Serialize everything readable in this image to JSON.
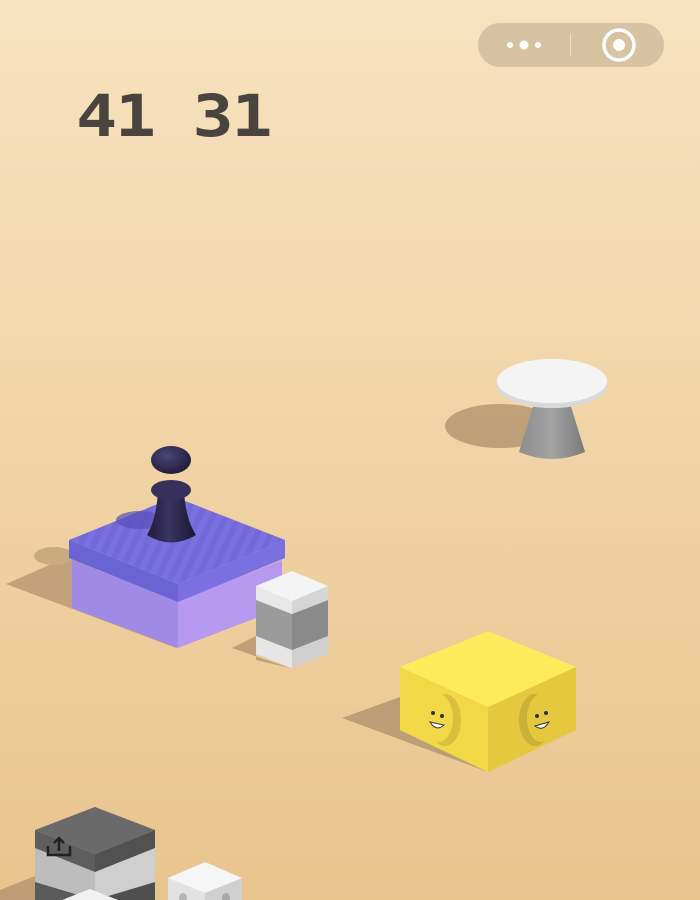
{
  "colors": {
    "background_top": "#f7e3bf",
    "background_bottom": "#e9c48d",
    "shadow": "#b89a73",
    "score_text": "#4a4440",
    "capsule": "#c8b79f",
    "purple_top": "#7a70e0",
    "purple_front": "#9f8be6",
    "purple_side": "#b79af0",
    "purple_rim": "#6b63d4",
    "player": "#2c2747",
    "yellow_top": "#fdeb5c",
    "yellow_left": "#f2d846",
    "yellow_right": "#e5c83e",
    "white_top": "#f4f4f4",
    "gray_band": "#9b9b9b",
    "dark_gray_top": "#6a6a6a"
  },
  "hud": {
    "score": "41 31",
    "more_icon": "more-dots-icon",
    "close_icon": "target-circle-icon",
    "share_icon": "share-icon"
  },
  "scene": {
    "player": "chess-pawn-player",
    "current_block": "purple-cushion-block",
    "blocks": [
      "white-stool-block",
      "white-gray-striped-block",
      "yellow-smiley-cube",
      "gray-striped-block",
      "small-white-block"
    ]
  }
}
